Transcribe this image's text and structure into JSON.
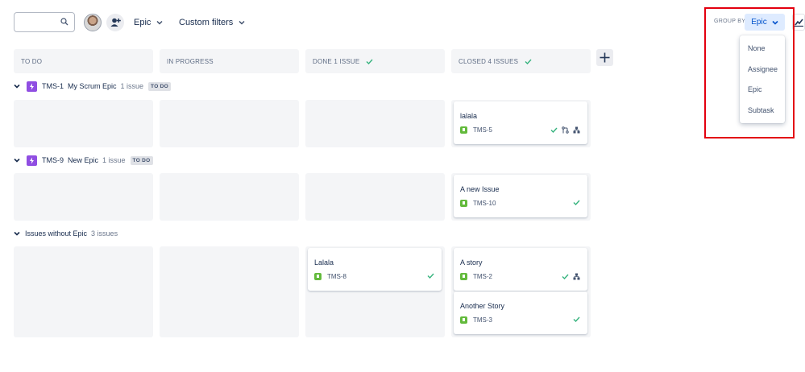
{
  "toolbar": {
    "search_placeholder": "",
    "filter_epic": "Epic",
    "filter_custom": "Custom filters",
    "group_by_label": "GROUP BY",
    "group_by_value": "Epic"
  },
  "group_by_menu": {
    "items": [
      "None",
      "Assignee",
      "Epic",
      "Subtask"
    ]
  },
  "columns": [
    {
      "label": "TO DO"
    },
    {
      "label": "IN PROGRESS"
    },
    {
      "label": "DONE 1 ISSUE"
    },
    {
      "label": "CLOSED 4 ISSUES"
    }
  ],
  "swimlanes": [
    {
      "key": "TMS-1",
      "name": "My Scrum Epic",
      "count": "1 issue",
      "status": "TO DO",
      "cards": [
        {
          "summary": "lalala",
          "key": "TMS-5"
        }
      ]
    },
    {
      "key": "TMS-9",
      "name": "New Epic",
      "count": "1 issue",
      "status": "TO DO",
      "cards": [
        {
          "summary": "A new Issue",
          "key": "TMS-10"
        }
      ]
    },
    {
      "name": "Issues without Epic",
      "count": "3 issues",
      "cards": [
        {
          "summary": "Lalala",
          "key": "TMS-8"
        },
        {
          "summary": "A story",
          "key": "TMS-2"
        },
        {
          "summary": "Another Story",
          "key": "TMS-3"
        }
      ]
    }
  ],
  "colors": {
    "accent": "#0052cc",
    "epic": "#904ee2",
    "story": "#63ba3c",
    "done": "#36b37e",
    "highlight": "#e3000f"
  },
  "icons": [
    "search-icon",
    "add-person-icon",
    "chevron-down-icon",
    "insights-icon",
    "plus-icon",
    "epic-icon",
    "story-icon",
    "check-icon",
    "branch-icon",
    "subtask-icon"
  ]
}
